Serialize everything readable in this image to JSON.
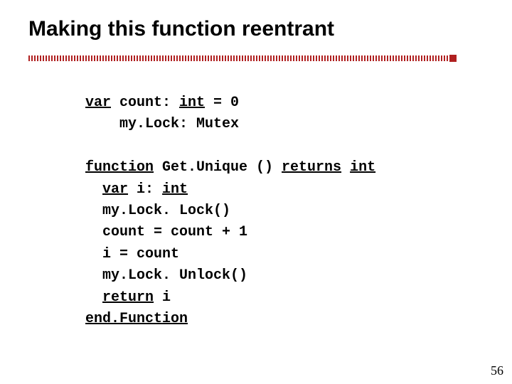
{
  "title": "Making this function reentrant",
  "code": {
    "l1a": "var",
    "l1b": " count: ",
    "l1c": "int",
    "l1d": " = 0",
    "l2": "    my.Lock: Mutex",
    "blank1": "",
    "l3a": "function",
    "l3b": " Get.Unique () ",
    "l3c": "returns",
    "l3d": " ",
    "l3e": "int",
    "l4a": "  ",
    "l4b": "var",
    "l4c": " i: ",
    "l4d": "int",
    "l5": "  my.Lock. Lock()",
    "l6": "  count = count + 1",
    "l7": "  i = count",
    "l8": "  my.Lock. Unlock()",
    "l9a": "  ",
    "l9b": "return",
    "l9c": " i",
    "l10": "end.Function"
  },
  "page_number": "56"
}
